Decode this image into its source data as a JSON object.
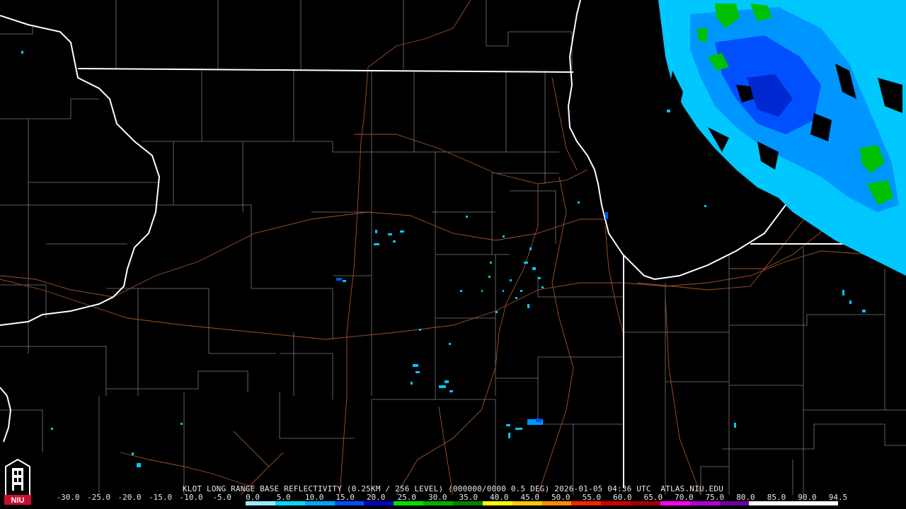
{
  "product_title": "KLOT LONG RANGE BASE REFLECTIVITY (0.25KM / 256 LEVEL) (000000/0000 0.5 DEG) 2026-01-05 04:36 UTC  ATLAS.NIU.EDU",
  "logo": {
    "text": "NIU",
    "icon": "niu-tower-logo-icon",
    "color": "#c8102e"
  },
  "scale": {
    "labels": [
      "-30.0",
      "-25.0",
      "-20.0",
      "-15.0",
      "-10.0",
      "-5.0",
      "0.0",
      "5.0",
      "10.0",
      "15.0",
      "20.0",
      "25.0",
      "30.0",
      "35.0",
      "40.0",
      "45.0",
      "50.0",
      "55.0",
      "60.0",
      "65.0",
      "70.0",
      "75.0",
      "80.0",
      "85.0",
      "90.0",
      "94.5"
    ],
    "colors": [
      "#000000",
      "#000000",
      "#000000",
      "#000000",
      "#000000",
      "#000000",
      "#9be8ff",
      "#00d8ff",
      "#00a6ff",
      "#0050ff",
      "#0000c8",
      "#00e000",
      "#00b000",
      "#008000",
      "#ffff00",
      "#ffc800",
      "#ff8c00",
      "#ff2000",
      "#d00000",
      "#a00000",
      "#ff00ff",
      "#b000d0",
      "#7000a0",
      "#ffffff",
      "#ffffff",
      "#ffffff"
    ]
  },
  "map_colors": {
    "state_line": "#ffffff",
    "county_line": "#7a7a7a",
    "highway": "#a0522d",
    "echo_light": "#00c8ff",
    "echo_mid": "#0096ff",
    "echo_blue": "#0040ff",
    "echo_green": "#00c000"
  }
}
